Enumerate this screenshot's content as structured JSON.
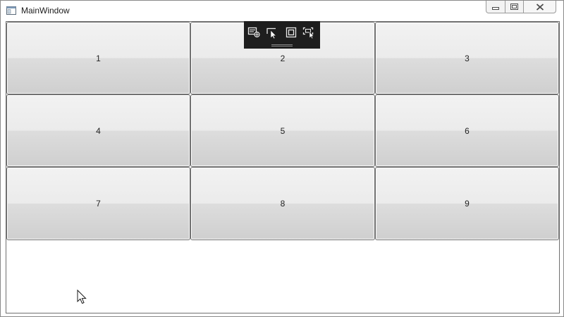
{
  "window": {
    "title": "MainWindow",
    "caption_buttons": {
      "minimize_icon": "minimize-icon",
      "maximize_icon": "maximize-icon",
      "close_icon": "close-icon"
    }
  },
  "grid": {
    "buttons": [
      {
        "label": "1"
      },
      {
        "label": "2"
      },
      {
        "label": "3"
      },
      {
        "label": "4"
      },
      {
        "label": "5"
      },
      {
        "label": "6"
      },
      {
        "label": "7"
      },
      {
        "label": "8"
      },
      {
        "label": "9"
      }
    ]
  },
  "designer_toolbar": {
    "tools": [
      "select-element-icon",
      "select-cursor-icon",
      "display-layout-adorners-icon",
      "track-focused-element-icon"
    ]
  },
  "colors": {
    "toolbar_bg": "#1e1e1e",
    "button_border": "#707070",
    "window_border": "#8a8a8a"
  }
}
